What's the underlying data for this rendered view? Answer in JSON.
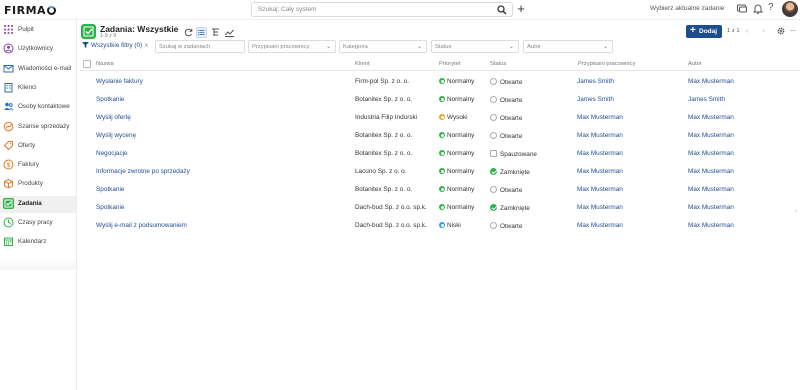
{
  "app": {
    "logo": "FIRMA",
    "logo_tail": "O"
  },
  "topbar": {
    "search_placeholder": "Szukaj: Cały system",
    "task_select": "Wybierz aktualne zadanie",
    "icons": [
      "search-icon",
      "plus-icon",
      "chat-icon",
      "bell-icon",
      "help-icon"
    ]
  },
  "sidebar": {
    "items": [
      {
        "label": "Pulpit",
        "icon": "grid-icon",
        "color": "#7a3fb0"
      },
      {
        "label": "Użytkownicy",
        "icon": "users-icon",
        "color": "#8e44ad"
      },
      {
        "label": "Wiadomości e-mail",
        "icon": "mail-icon",
        "color": "#2c6fb5"
      },
      {
        "label": "Klienci",
        "icon": "building-icon",
        "color": "#2c6fb5"
      },
      {
        "label": "Osoby kontaktowe",
        "icon": "contacts-icon",
        "color": "#2c6fb5"
      },
      {
        "label": "Szanse sprzedaży",
        "icon": "opportunity-icon",
        "color": "#e07b22"
      },
      {
        "label": "Oferty",
        "icon": "offer-icon",
        "color": "#e07b22"
      },
      {
        "label": "Faktury",
        "icon": "invoice-icon",
        "color": "#e07b22"
      },
      {
        "label": "Produkty",
        "icon": "box-icon",
        "color": "#e07b22"
      },
      {
        "label": "Zadania",
        "icon": "tasks-icon",
        "color": "#2fb24a",
        "active": true
      },
      {
        "label": "Czasy pracy",
        "icon": "clock-icon",
        "color": "#2fb24a"
      },
      {
        "label": "Kalendarz",
        "icon": "calendar-icon",
        "color": "#2fb24a"
      }
    ]
  },
  "header": {
    "title": "Zadania: Wszystkie",
    "count": "1-9 z 9",
    "add_label": "Dodaj",
    "pager": "1 z 1"
  },
  "filters": {
    "toggle_label": "Wszystkie filtry (0)",
    "search_placeholder": "Szukaj w zadaniach",
    "assigned_placeholder": "Przypisani pracownicy",
    "category_placeholder": "Kategoria",
    "status_placeholder": "Status",
    "author_placeholder": "Autor"
  },
  "table": {
    "columns": [
      "Nazwa",
      "Klient",
      "Priorytet",
      "Status",
      "Przypisani pracownicy",
      "Autor"
    ],
    "rows": [
      {
        "name": "Wysłanie faktury",
        "client": "Firm-pol Sp. z o. o.",
        "priority": "Normalny",
        "pcolor": "#2fb24a",
        "status": "Otwarte",
        "stype": "open",
        "assigned": "James Smith",
        "author": "Max Musterman"
      },
      {
        "name": "Spotkanie",
        "client": "Botanitex Sp. z o. o.",
        "priority": "Normalny",
        "pcolor": "#2fb24a",
        "status": "Otwarte",
        "stype": "open",
        "assigned": "James Smith",
        "author": "James Smith"
      },
      {
        "name": "Wyślij ofertę",
        "client": "Industria Filip Indurski",
        "priority": "Wysoki",
        "pcolor": "#e0a51c",
        "status": "Otwarte",
        "stype": "open",
        "assigned": "Max Musterman",
        "author": "Max Musterman"
      },
      {
        "name": "Wyślij wycenę",
        "client": "Botanitex Sp. z o. o.",
        "priority": "Normalny",
        "pcolor": "#2fb24a",
        "status": "Otwarte",
        "stype": "open",
        "assigned": "Max Musterman",
        "author": "Max Musterman"
      },
      {
        "name": "Negocjacje",
        "client": "Botanitex Sp. z o. o.",
        "priority": "Normalny",
        "pcolor": "#2fb24a",
        "status": "Spauzowane",
        "stype": "paused",
        "assigned": "Max Musterman",
        "author": "Max Musterman"
      },
      {
        "name": "Informacje zwrotne po sprzedaży",
        "client": "Lacuno Sp. z o. o.",
        "priority": "Normalny",
        "pcolor": "#2fb24a",
        "status": "Zamknięte",
        "stype": "closed",
        "assigned": "Max Musterman",
        "author": "Max Musterman"
      },
      {
        "name": "Spotkanie",
        "client": "Botanitex Sp. z o. o.",
        "priority": "Normalny",
        "pcolor": "#2fb24a",
        "status": "Otwarte",
        "stype": "open",
        "assigned": "Max Musterman",
        "author": "Max Musterman"
      },
      {
        "name": "Spotkanie",
        "client": "Dach-bud Sp. z o.o. sp.k.",
        "priority": "Normalny",
        "pcolor": "#2fb24a",
        "status": "Zamknięte",
        "stype": "closed",
        "assigned": "Max Musterman",
        "author": "Max Musterman"
      },
      {
        "name": "Wyślij e-mail z podsumowaniem",
        "client": "Dach-bud Sp. z o.o. sp.k.",
        "priority": "Niski",
        "pcolor": "#2a9fe0",
        "status": "Otwarte",
        "stype": "open",
        "assigned": "Max Musterman",
        "author": "Max Musterman"
      }
    ]
  }
}
